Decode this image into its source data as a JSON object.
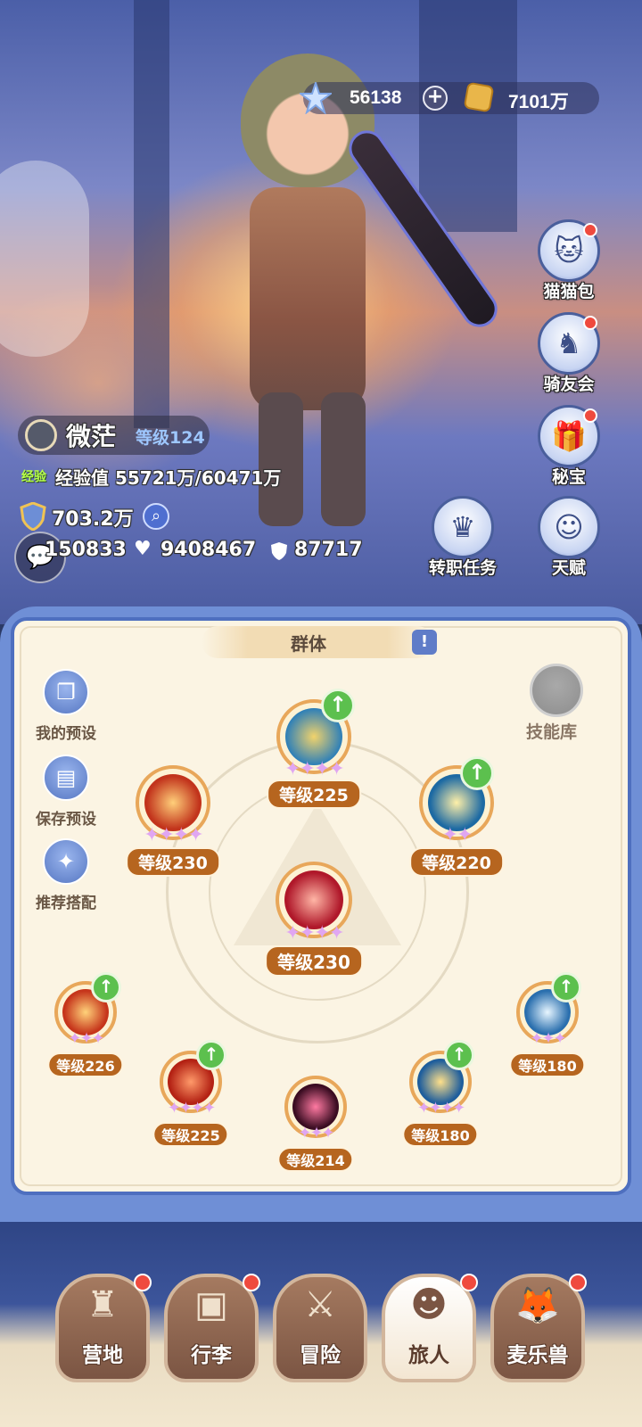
{
  "currency": {
    "gems": "56138",
    "plus": "+",
    "gold": "7101万"
  },
  "side_menu": [
    {
      "label": "猫猫包",
      "icon": "cat-bag-icon",
      "glyph": "🐱",
      "badge": true
    },
    {
      "label": "骑友会",
      "icon": "horse-icon",
      "glyph": "♞",
      "badge": true
    },
    {
      "label": "秘宝",
      "icon": "treasure-chest-icon",
      "glyph": "🎁",
      "badge": true
    },
    {
      "label": "转职任务",
      "icon": "crown-icon",
      "glyph": "♛",
      "badge": false
    },
    {
      "label": "天赋",
      "icon": "brain-head-icon",
      "glyph": "☺",
      "badge": false
    }
  ],
  "player": {
    "name": "微茫",
    "level_label": "等级124",
    "exp_tag": "经验",
    "exp_text": "经验值 55721万/60471万",
    "power": "703.2万",
    "attack": "150833",
    "hp": "9408467",
    "defense": "87717"
  },
  "panel": {
    "tab_label": "群体",
    "tab_icon": "!",
    "skill_library_label": "技能库",
    "tools": [
      {
        "label": "我的预设",
        "icon": "preset-cards-icon",
        "glyph": "❐"
      },
      {
        "label": "保存预设",
        "icon": "save-disk-icon",
        "glyph": "▤"
      },
      {
        "label": "推荐搭配",
        "icon": "recommend-icon",
        "glyph": "✦"
      }
    ],
    "skills": [
      {
        "level": "等级225",
        "upgradable": true
      },
      {
        "level": "等级230",
        "upgradable": false
      },
      {
        "level": "等级220",
        "upgradable": true
      },
      {
        "level": "等级230",
        "upgradable": false
      },
      {
        "level": "等级226",
        "upgradable": true
      },
      {
        "level": "等级225",
        "upgradable": true
      },
      {
        "level": "等级214",
        "upgradable": false
      },
      {
        "level": "等级180",
        "upgradable": true
      },
      {
        "level": "等级180",
        "upgradable": true
      }
    ]
  },
  "nav": [
    {
      "label": "营地",
      "icon": "castle-icon",
      "glyph": "♜",
      "active": false
    },
    {
      "label": "行李",
      "icon": "luggage-icon",
      "glyph": "▣",
      "active": false
    },
    {
      "label": "冒险",
      "icon": "crossed-swords-icon",
      "glyph": "⚔",
      "active": false
    },
    {
      "label": "旅人",
      "icon": "traveler-portrait-icon",
      "glyph": "☻",
      "active": true
    },
    {
      "label": "麦乐兽",
      "icon": "pet-fox-icon",
      "glyph": "🦊",
      "active": false
    }
  ]
}
